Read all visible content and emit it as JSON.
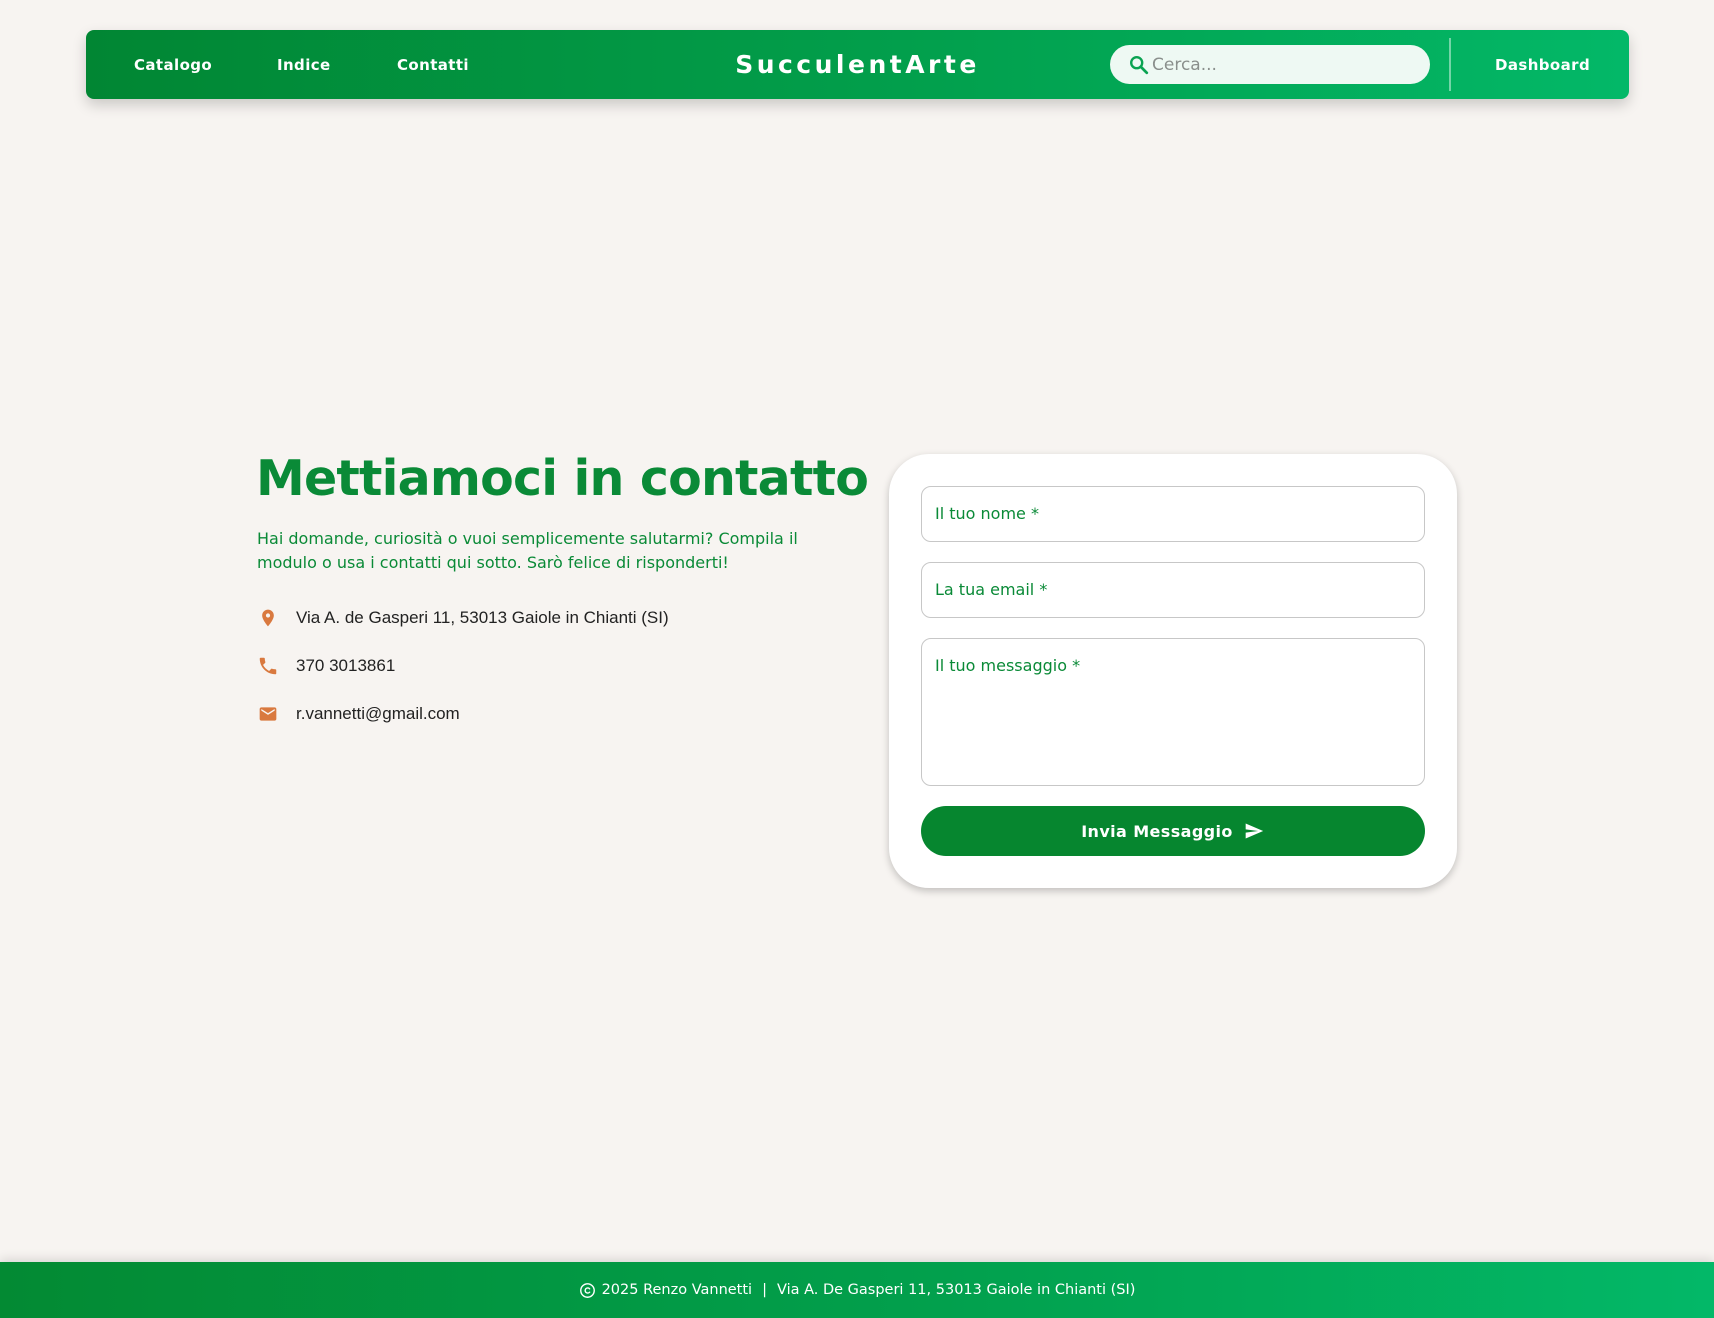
{
  "nav": {
    "links": [
      "Catalogo",
      "Indice",
      "Contatti"
    ],
    "brand": "SucculentArte",
    "search_placeholder": "Cerca...",
    "dashboard": "Dashboard"
  },
  "contact": {
    "title": "Mettiamoci in contatto",
    "text": "Hai domande, curiosità o vuoi semplicemente salutarmi? Compila il modulo o usa i contatti qui sotto. Sarò felice di risponderti!",
    "address": "Via A. de Gasperi 11, 53013 Gaiole in Chianti (SI)",
    "phone": "370 3013861",
    "email": "r.vannetti@gmail.com"
  },
  "form": {
    "name_label": "Il tuo nome *",
    "email_label": "La tua email *",
    "message_label": "Il tuo messaggio *",
    "submit_label": "Invia Messaggio"
  },
  "footer": {
    "copyright": "2025 Renzo Vannetti",
    "separator": "|",
    "address": "Via A. De Gasperi 11, 53013 Gaiole in Chianti (SI)"
  },
  "colors": {
    "brand_green": "#0a8a37",
    "accent_orange": "#d9793f",
    "background": "#f7f4f1"
  },
  "icons": [
    "search-icon",
    "location-pin-icon",
    "phone-icon",
    "mail-icon",
    "send-icon",
    "copyright-icon"
  ]
}
